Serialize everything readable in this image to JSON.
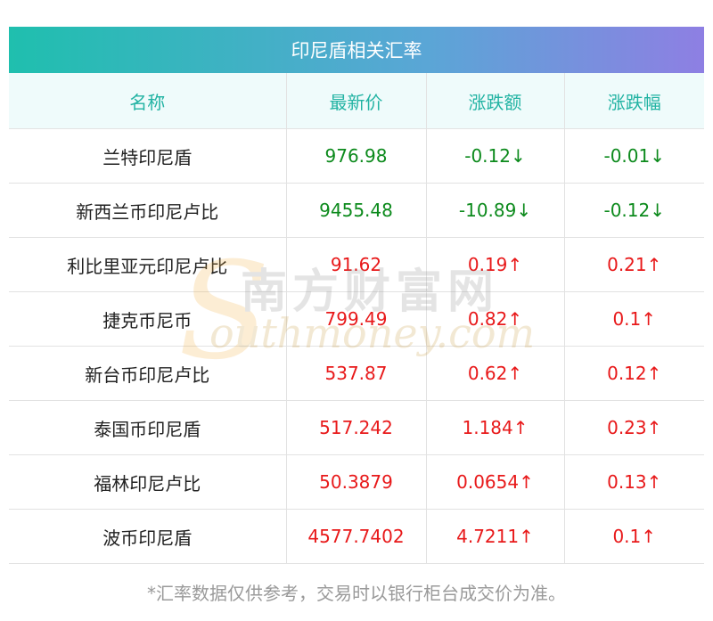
{
  "table": {
    "title": "印尼盾相关汇率",
    "headers": [
      "名称",
      "最新价",
      "涨跌额",
      "涨跌幅"
    ],
    "rows": [
      {
        "name": "兰特印尼盾",
        "price": "976.98",
        "change": "-0.12↓",
        "pct": "-0.01↓",
        "direction": "down"
      },
      {
        "name": "新西兰币印尼卢比",
        "price": "9455.48",
        "change": "-10.89↓",
        "pct": "-0.12↓",
        "direction": "down"
      },
      {
        "name": "利比里亚元印尼卢比",
        "price": "91.62",
        "change": "0.19↑",
        "pct": "0.21↑",
        "direction": "up"
      },
      {
        "name": "捷克币尼币",
        "price": "799.49",
        "change": "0.82↑",
        "pct": "0.1↑",
        "direction": "up"
      },
      {
        "name": "新台币印尼卢比",
        "price": "537.87",
        "change": "0.62↑",
        "pct": "0.12↑",
        "direction": "up"
      },
      {
        "name": "泰国币印尼盾",
        "price": "517.242",
        "change": "1.184↑",
        "pct": "0.23↑",
        "direction": "up"
      },
      {
        "name": "福林印尼卢比",
        "price": "50.3879",
        "change": "0.0654↑",
        "pct": "0.13↑",
        "direction": "up"
      },
      {
        "name": "波币印尼盾",
        "price": "4577.7402",
        "change": "4.7211↑",
        "pct": "0.1↑",
        "direction": "up"
      }
    ]
  },
  "footnote": "*汇率数据仅供参考，交易时以银行柜台成交价为准。",
  "watermark": {
    "cn": "南方财富网",
    "en": "outhmoney.com",
    "s": "S"
  },
  "colors": {
    "up": "#e8191a",
    "down": "#0c8a1c",
    "header_text": "#22b3a3"
  }
}
